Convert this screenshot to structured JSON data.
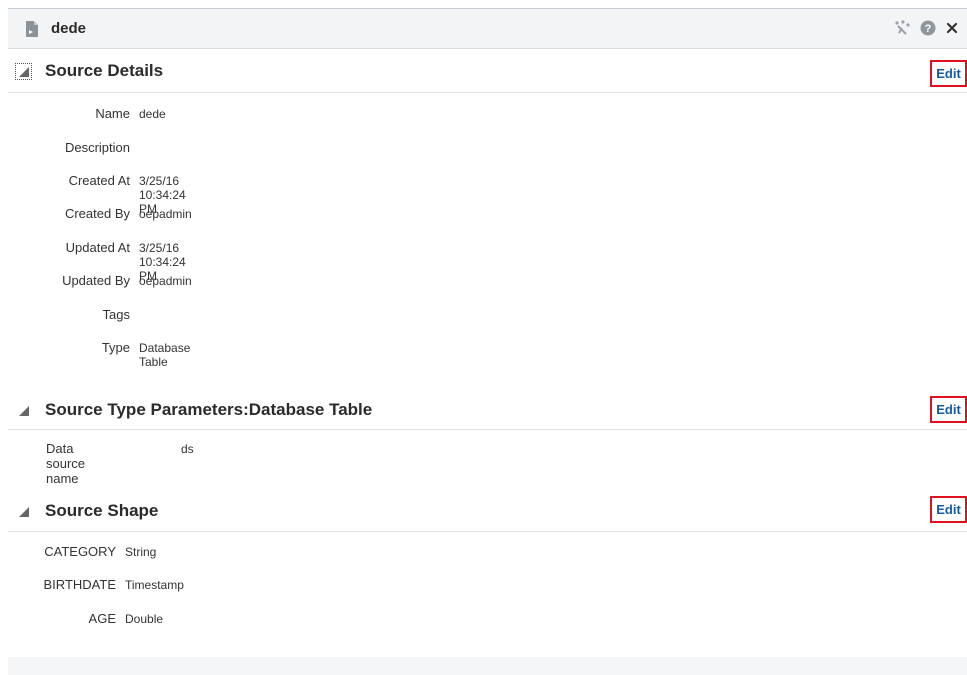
{
  "panel": {
    "title": "dede",
    "toolbar_icons": [
      "pin-icon",
      "help-icon",
      "close-icon"
    ]
  },
  "source_details": {
    "header": "Source Details",
    "edit_label": "Edit",
    "fields": [
      {
        "label": "Name",
        "value": "dede"
      },
      {
        "label": "Description",
        "value": ""
      },
      {
        "label": "Created At",
        "value": "3/25/16 10:34:24 PM"
      },
      {
        "label": "Created By",
        "value": "oepadmin"
      },
      {
        "label": "Updated At",
        "value": "3/25/16 10:34:24 PM"
      },
      {
        "label": "Updated By",
        "value": "oepadmin"
      },
      {
        "label": "Tags",
        "value": ""
      },
      {
        "label": "Type",
        "value": "Database Table"
      }
    ]
  },
  "source_type_parameters": {
    "header": "Source Type Parameters:Database Table",
    "edit_label": "Edit",
    "fields": [
      {
        "label": "Data source name",
        "value": "ds"
      }
    ]
  },
  "source_shape": {
    "header": "Source Shape",
    "edit_label": "Edit",
    "fields": [
      {
        "label": "CATEGORY",
        "value": "String"
      },
      {
        "label": "BIRTHDATE",
        "value": "Timestamp"
      },
      {
        "label": "AGE",
        "value": "Double"
      }
    ]
  },
  "colors": {
    "link": "#145c9e",
    "highlight_border": "#e0101e",
    "header_bg": "#f3f4f6"
  }
}
